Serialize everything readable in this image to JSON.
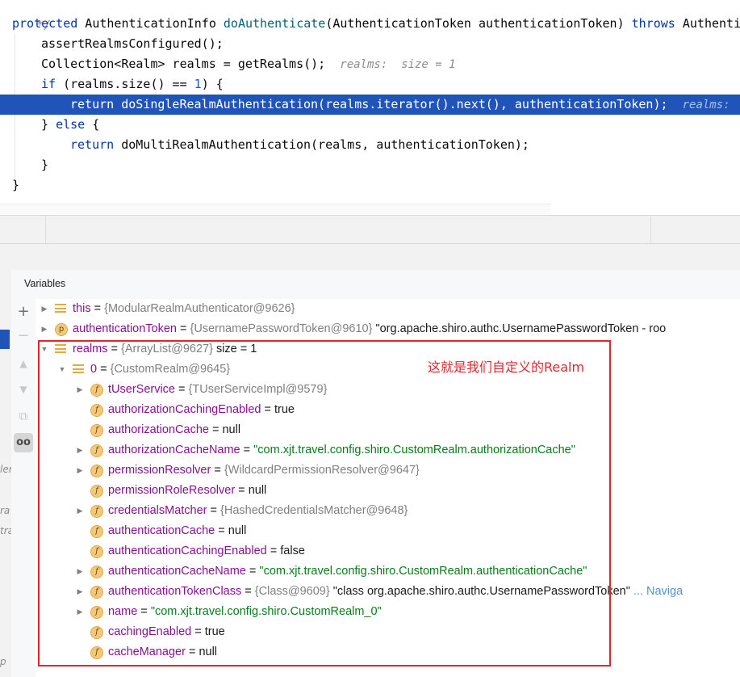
{
  "editor": {
    "lines": [
      {
        "text": " */",
        "kind": "comment"
      },
      {
        "kw": "protected",
        "text": " AuthenticationInfo ",
        "method": "doAuthenticate",
        "rest": "(AuthenticationToken authenticationToken) ",
        "kw2": "throws",
        "tail": " Authentic"
      },
      {
        "text": "assertRealmsConfigured();"
      },
      {
        "text": "Collection<Realm> realms = getRealms();",
        "hint": "realms:  size = 1"
      },
      {
        "kw": "if",
        "pre": " (realms.size() == ",
        "num": "1",
        "post": ") {"
      },
      {
        "kw": "return",
        "text": " doSingleRealmAuthentication(realms.iterator().next(), authenticationToken);",
        "hint": "realms: "
      },
      {
        "text": "} ",
        "kw": "else",
        "post": " {"
      },
      {
        "kw": "return",
        "text": " doMultiRealmAuthentication(realms, authenticationToken);"
      },
      {
        "text": "}"
      },
      {
        "text": "}"
      }
    ]
  },
  "panel": {
    "title": "Variables",
    "toolbar": {
      "add": "+",
      "remove": "−",
      "up": "▲",
      "down": "▼",
      "copy": "⧉",
      "watch": "oo"
    },
    "left_fragments": [
      "ler",
      "ra",
      "tra",
      "p"
    ]
  },
  "variables": [
    {
      "indent": 0,
      "expand": "collapsed",
      "icon": "list",
      "name": "this",
      "eq": " = ",
      "obj": "{ModularRealmAuthenticator@9626}"
    },
    {
      "indent": 0,
      "expand": "collapsed",
      "icon": "param",
      "name": "authenticationToken",
      "eq": " = ",
      "obj": "{UsernamePasswordToken@9610}",
      "extra": " \"org.apache.shiro.authc.UsernamePasswordToken - roo"
    },
    {
      "indent": 0,
      "expand": "expanded",
      "icon": "list",
      "name": "realms",
      "eq": " = ",
      "obj": "{ArrayList@9627}",
      "extra": "  size = 1"
    },
    {
      "indent": 1,
      "expand": "expanded",
      "icon": "list",
      "name": "0",
      "eq": " = ",
      "obj": "{CustomRealm@9645}"
    },
    {
      "indent": 2,
      "expand": "collapsed",
      "icon": "field",
      "name": "tUserService",
      "eq": " = ",
      "obj": "{TUserServiceImpl@9579}"
    },
    {
      "indent": 2,
      "expand": "none",
      "icon": "field",
      "name": "authorizationCachingEnabled",
      "eq": " = ",
      "value": "true"
    },
    {
      "indent": 2,
      "expand": "none",
      "icon": "field",
      "name": "authorizationCache",
      "eq": " = ",
      "value": "null"
    },
    {
      "indent": 2,
      "expand": "collapsed",
      "icon": "field",
      "name": "authorizationCacheName",
      "eq": " = ",
      "str": "\"com.xjt.travel.config.shiro.CustomRealm.authorizationCache\""
    },
    {
      "indent": 2,
      "expand": "collapsed",
      "icon": "field",
      "name": "permissionResolver",
      "eq": " = ",
      "obj": "{WildcardPermissionResolver@9647}"
    },
    {
      "indent": 2,
      "expand": "none",
      "icon": "field",
      "name": "permissionRoleResolver",
      "eq": " = ",
      "value": "null"
    },
    {
      "indent": 2,
      "expand": "collapsed",
      "icon": "field",
      "name": "credentialsMatcher",
      "eq": " = ",
      "obj": "{HashedCredentialsMatcher@9648}"
    },
    {
      "indent": 2,
      "expand": "none",
      "icon": "field",
      "name": "authenticationCache",
      "eq": " = ",
      "value": "null"
    },
    {
      "indent": 2,
      "expand": "none",
      "icon": "field",
      "name": "authenticationCachingEnabled",
      "eq": " = ",
      "value": "false"
    },
    {
      "indent": 2,
      "expand": "collapsed",
      "icon": "field",
      "name": "authenticationCacheName",
      "eq": " = ",
      "str": "\"com.xjt.travel.config.shiro.CustomRealm.authenticationCache\""
    },
    {
      "indent": 2,
      "expand": "collapsed",
      "icon": "field",
      "name": "authenticationTokenClass",
      "eq": " = ",
      "obj": "{Class@9609}",
      "extra": " \"class org.apache.shiro.authc.UsernamePasswordToken\"",
      "link": " ... Naviga"
    },
    {
      "indent": 2,
      "expand": "collapsed",
      "icon": "field",
      "name": "name",
      "eq": " = ",
      "str": "\"com.xjt.travel.config.shiro.CustomRealm_0\""
    },
    {
      "indent": 2,
      "expand": "none",
      "icon": "field",
      "name": "cachingEnabled",
      "eq": " = ",
      "value": "true"
    },
    {
      "indent": 2,
      "expand": "none",
      "icon": "field",
      "name": "cacheManager",
      "eq": " = ",
      "value": "null"
    }
  ],
  "annotation": "这就是我们自定义的Realm",
  "icons": {
    "field": "f",
    "param": "p"
  },
  "colors": {
    "highlight": "#2154b8",
    "keyword": "#0033b3",
    "field_name": "#871094",
    "string": "#067d17",
    "annotation": "#e3262b"
  }
}
